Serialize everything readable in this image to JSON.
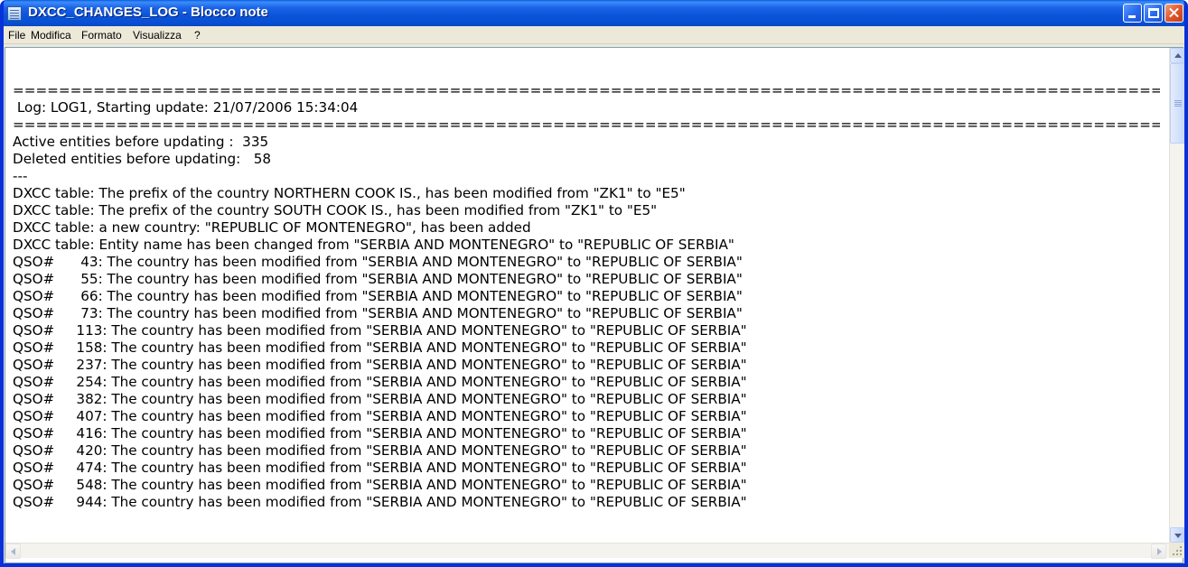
{
  "window": {
    "title": "DXCC_CHANGES_LOG - Blocco note"
  },
  "menu": {
    "items": [
      "File",
      "Modifica",
      "Formato",
      "Visualizza",
      "?"
    ]
  },
  "document": {
    "lines": [
      "====================================================================================================",
      " Log: LOG1, Starting update: 21/07/2006 15:34:04",
      "====================================================================================================",
      "Active entities before updating :  335",
      "Deleted entities before updating:   58",
      "---",
      "DXCC table: The prefix of the country NORTHERN COOK IS., has been modified from \"ZK1\" to \"E5\"",
      "DXCC table: The prefix of the country SOUTH COOK IS., has been modified from \"ZK1\" to \"E5\"",
      "DXCC table: a new country: \"REPUBLIC OF MONTENEGRO\", has been added",
      "DXCC table: Entity name has been changed from \"SERBIA AND MONTENEGRO\" to \"REPUBLIC OF SERBIA\"",
      "QSO#      43: The country has been modified from \"SERBIA AND MONTENEGRO\" to \"REPUBLIC OF SERBIA\"",
      "QSO#      55: The country has been modified from \"SERBIA AND MONTENEGRO\" to \"REPUBLIC OF SERBIA\"",
      "QSO#      66: The country has been modified from \"SERBIA AND MONTENEGRO\" to \"REPUBLIC OF SERBIA\"",
      "QSO#      73: The country has been modified from \"SERBIA AND MONTENEGRO\" to \"REPUBLIC OF SERBIA\"",
      "QSO#     113: The country has been modified from \"SERBIA AND MONTENEGRO\" to \"REPUBLIC OF SERBIA\"",
      "QSO#     158: The country has been modified from \"SERBIA AND MONTENEGRO\" to \"REPUBLIC OF SERBIA\"",
      "QSO#     237: The country has been modified from \"SERBIA AND MONTENEGRO\" to \"REPUBLIC OF SERBIA\"",
      "QSO#     254: The country has been modified from \"SERBIA AND MONTENEGRO\" to \"REPUBLIC OF SERBIA\"",
      "QSO#     382: The country has been modified from \"SERBIA AND MONTENEGRO\" to \"REPUBLIC OF SERBIA\"",
      "QSO#     407: The country has been modified from \"SERBIA AND MONTENEGRO\" to \"REPUBLIC OF SERBIA\"",
      "QSO#     416: The country has been modified from \"SERBIA AND MONTENEGRO\" to \"REPUBLIC OF SERBIA\"",
      "QSO#     420: The country has been modified from \"SERBIA AND MONTENEGRO\" to \"REPUBLIC OF SERBIA\"",
      "QSO#     474: The country has been modified from \"SERBIA AND MONTENEGRO\" to \"REPUBLIC OF SERBIA\"",
      "QSO#     548: The country has been modified from \"SERBIA AND MONTENEGRO\" to \"REPUBLIC OF SERBIA\"",
      "QSO#     944: The country has been modified from \"SERBIA AND MONTENEGRO\" to \"REPUBLIC OF SERBIA\""
    ]
  },
  "icons": {
    "app": "notepad-icon",
    "minimize": "minimize-icon",
    "maximize": "maximize-icon",
    "close": "close-icon",
    "scroll_up": "arrow-up-icon",
    "scroll_down": "arrow-down-icon",
    "scroll_left": "arrow-left-icon",
    "scroll_right": "arrow-right-icon",
    "resize": "resize-grip-icon"
  },
  "colors": {
    "titlebar": "#0b54d9",
    "window_border": "#0831d9",
    "close_button": "#e1582e",
    "menubar": "#ece9d8",
    "editor_background": "#ffffff",
    "text": "#000000"
  }
}
